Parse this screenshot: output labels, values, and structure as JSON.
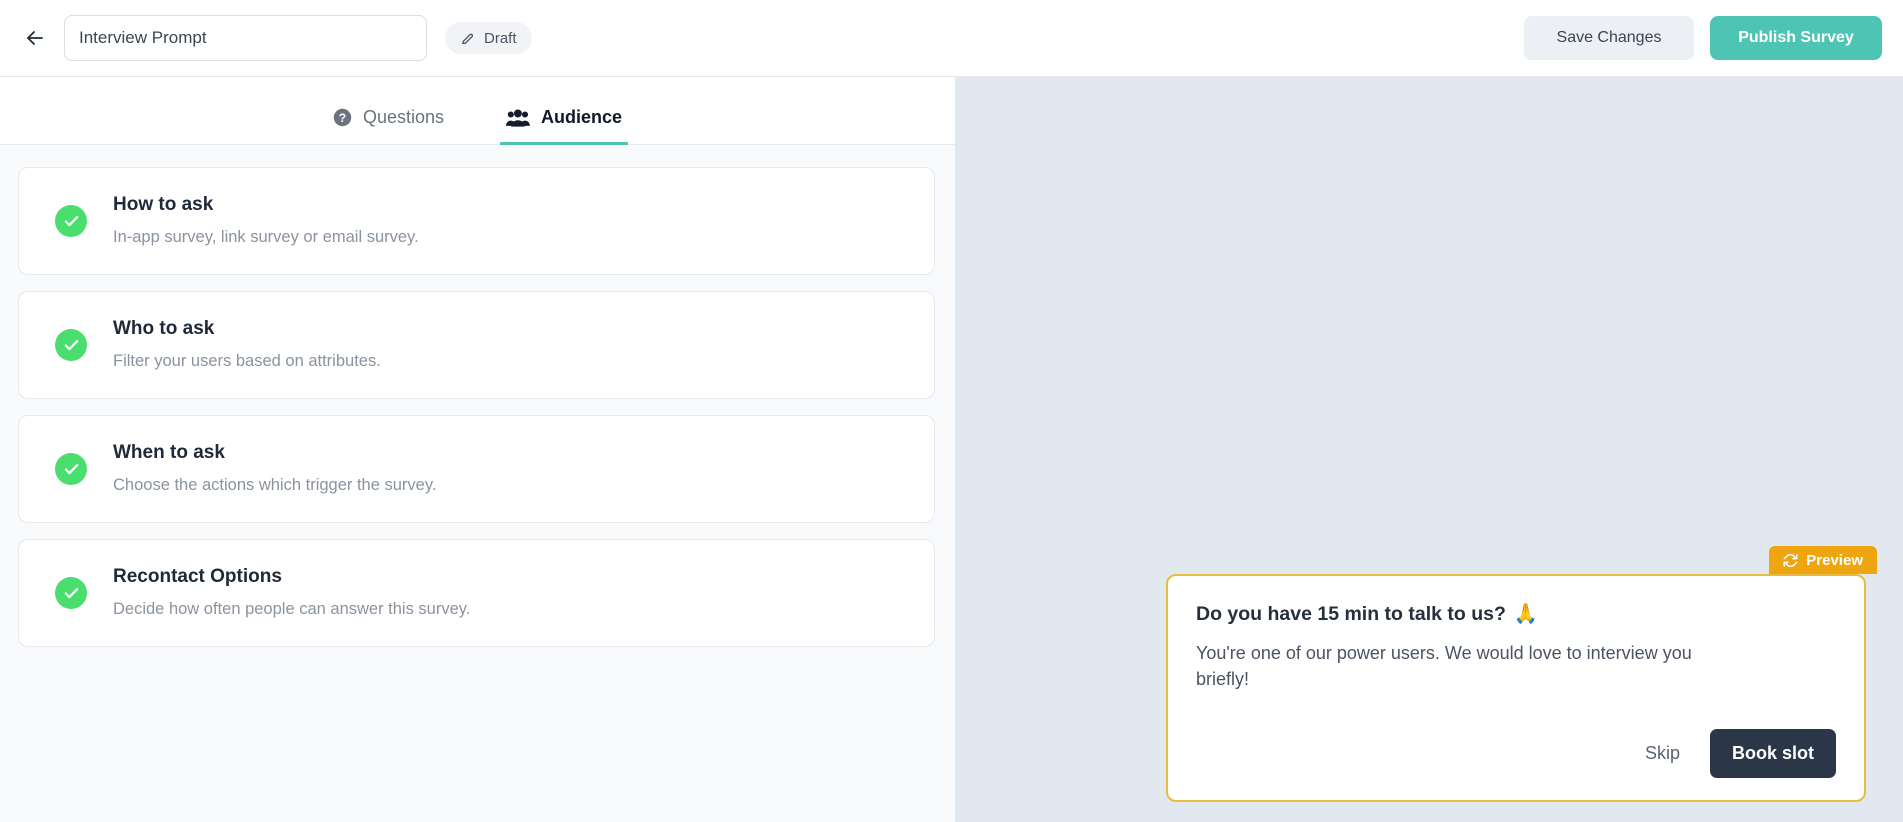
{
  "topbar": {
    "back_icon": "arrow-left-icon",
    "survey_title": "Interview Prompt",
    "survey_title_placeholder": "Survey name",
    "status_badge": {
      "icon": "pencil-edit-icon",
      "label": "Draft"
    },
    "save_label": "Save Changes",
    "publish_label": "Publish Survey"
  },
  "tabs": [
    {
      "id": "questions",
      "label": "Questions",
      "icon": "question-circle-icon",
      "active": false
    },
    {
      "id": "audience",
      "label": "Audience",
      "icon": "users-group-icon",
      "active": true
    }
  ],
  "cards": [
    {
      "id": "how-to-ask",
      "title": "How to ask",
      "subtitle": "In-app survey, link survey or email survey.",
      "status_icon": "check-circle-icon",
      "complete": true
    },
    {
      "id": "who-to-ask",
      "title": "Who to ask",
      "subtitle": "Filter your users based on attributes.",
      "status_icon": "check-circle-icon",
      "complete": true
    },
    {
      "id": "when-to-ask",
      "title": "When to ask",
      "subtitle": "Choose the actions which trigger the survey.",
      "status_icon": "check-circle-icon",
      "complete": true
    },
    {
      "id": "recontact-options",
      "title": "Recontact Options",
      "subtitle": "Decide how often people can answer this survey.",
      "status_icon": "check-circle-icon",
      "complete": true
    }
  ],
  "preview": {
    "badge": {
      "icon": "refresh-sync-icon",
      "label": "Preview"
    },
    "survey": {
      "question": "Do you have 15 min to talk to us?",
      "emoji": "🙏",
      "body": "You're one of our power users. We would love to interview you briefly!",
      "skip_label": "Skip",
      "primary_label": "Book slot"
    }
  },
  "colors": {
    "accent_teal": "#4ec5b4",
    "check_green": "#4ade6e",
    "preview_orange": "#efa50f",
    "card_border_gold": "#e7bc3f",
    "primary_dark": "#2b3649",
    "panel_bg": "#e2e8ef"
  }
}
